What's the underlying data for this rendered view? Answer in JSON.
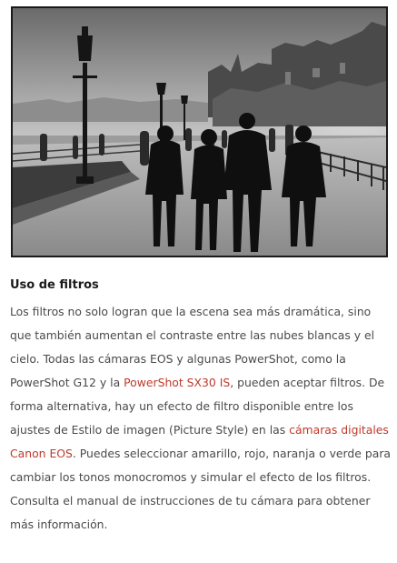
{
  "article": {
    "title": "Uso de filtros",
    "para_part1": "Los filtros no solo logran que la escena sea más dramática, sino que también aumentan el contraste entre las nubes blancas y el cielo. Todas las cámaras EOS y algunas PowerShot, como la PowerShot G12 y la ",
    "link1": "PowerShot SX30 IS",
    "para_part2": ", pueden aceptar filtros. De forma alternativa, hay un efecto de filtro disponible entre los ajustes de Estilo de imagen (Picture Style) en las ",
    "link2": "cámaras digitales Canon EOS",
    "para_part3": ". Puedes seleccionar amarillo, rojo, naranja o verde para cambiar los tonos monocromos y simular el efecto de los filtros. Consulta el manual de instrucciones de tu cámara para obtener más información."
  },
  "colors": {
    "link": "#c0392b",
    "body_text": "#4a4a4a",
    "title_text": "#1a1a1a"
  }
}
